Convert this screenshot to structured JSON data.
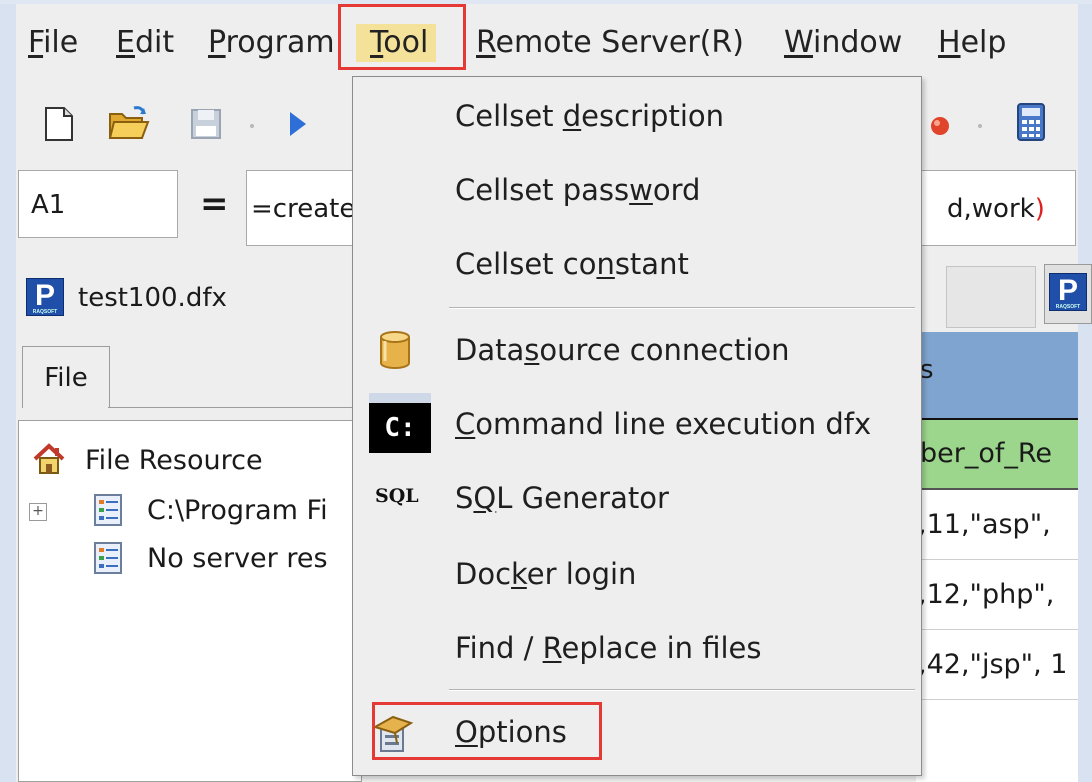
{
  "menubar": {
    "items": [
      {
        "before": "",
        "key": "F",
        "after": "ile"
      },
      {
        "before": "",
        "key": "E",
        "after": "dit"
      },
      {
        "before": "",
        "key": "P",
        "after": "rogram"
      },
      {
        "before": "",
        "key": "T",
        "after": "ool"
      },
      {
        "before": "",
        "key": "R",
        "after": "emote Server(R)"
      },
      {
        "before": "",
        "key": "W",
        "after": "indow"
      },
      {
        "before": "",
        "key": "H",
        "after": "elp"
      }
    ]
  },
  "formula": {
    "cell_ref": "A1",
    "equals_sign": "=",
    "expression_start": "=create",
    "expression_end_text": "d,work",
    "expression_end_paren": ")"
  },
  "document": {
    "title": "test100.dfx",
    "icon_letter": "P",
    "icon_caption": "RAQSOFT"
  },
  "left_panel": {
    "tab_label": "File",
    "tree": {
      "root": "File Resource",
      "child1": "C:\\Program Fi",
      "child2": "No server res"
    }
  },
  "grid": {
    "header_char": "s",
    "col_header": "ber_of_Re",
    "rows": [
      ",11,\"asp\",",
      ",12,\"php\",",
      ",42,\"jsp\", 1"
    ]
  },
  "tool_menu": {
    "items": [
      {
        "before": "Cellset ",
        "key": "d",
        "after": "escription"
      },
      {
        "before": "Cellset pass",
        "key": "w",
        "after": "ord"
      },
      {
        "before": "Cellset co",
        "key": "n",
        "after": "stant"
      },
      {
        "before": "Data",
        "key": "s",
        "after": "ource connection"
      },
      {
        "before": "",
        "key": "C",
        "after": "ommand line execution dfx"
      },
      {
        "before": "S",
        "key": "Q",
        "after": "L Generator"
      },
      {
        "before": "Doc",
        "key": "k",
        "after": "er login"
      },
      {
        "before": "Find / ",
        "key": "R",
        "after": "eplace in files"
      },
      {
        "before": "",
        "key": "O",
        "after": "ptions"
      }
    ],
    "cmd_icon_text": "C:",
    "sql_icon_text": "SQL"
  },
  "colors": {
    "highlight_box": "#e53935",
    "menu_active_bg": "#f5e29a",
    "grid_header": "#7fa4cf",
    "grid_col_header": "#9bd68c"
  }
}
